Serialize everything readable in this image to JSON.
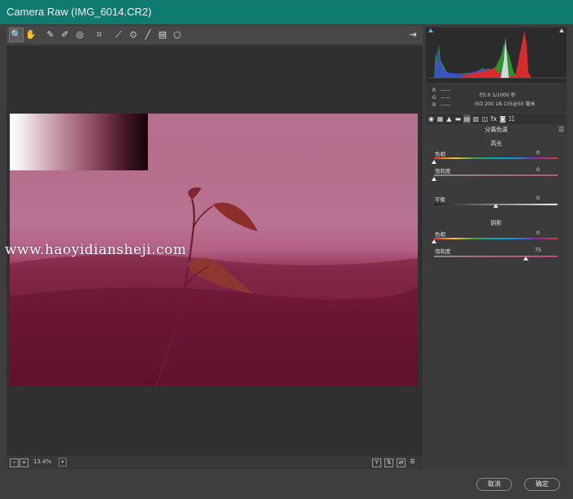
{
  "window": {
    "title": "Camera Raw (IMG_6014.CR2)"
  },
  "toolbar": {
    "tools": [
      {
        "name": "zoom-tool",
        "glyph": "🔍"
      },
      {
        "name": "hand-tool",
        "glyph": "✋"
      },
      {
        "name": "white-balance-tool",
        "glyph": "✎"
      },
      {
        "name": "color-sampler-tool",
        "glyph": "✐"
      },
      {
        "name": "targeted-adjustment-tool",
        "glyph": "◎"
      },
      {
        "name": "crop-tool",
        "glyph": "⌗"
      },
      {
        "name": "straighten-tool",
        "glyph": "⟋"
      },
      {
        "name": "red-eye-tool",
        "glyph": "⊙"
      },
      {
        "name": "brush-tool",
        "glyph": "╱"
      },
      {
        "name": "graduated-filter-tool",
        "glyph": "▤"
      },
      {
        "name": "radial-filter-tool",
        "glyph": "○"
      }
    ],
    "open_glyph": "⇥"
  },
  "watermark": {
    "text": "www.haoyidiansheji.com"
  },
  "statusbar": {
    "zoom_out": "−",
    "zoom_in": "+",
    "zoom": "13.4%",
    "dd": "▾",
    "btn_y": "Y",
    "btn_a": "⇅",
    "btn_b": "⇄",
    "btn_c": "☰"
  },
  "meta": {
    "r_label": "R",
    "g_label": "G",
    "b_label": "B",
    "r_val": "——",
    "g_val": "——",
    "b_val": "——",
    "aperture_shutter": "f/5.6   1/1000 秒",
    "iso_lens": "ISO 200   18-135@50 毫米"
  },
  "panel": {
    "title": "分离色调",
    "highlights": "高光",
    "hl_hue_label": "色相",
    "hl_hue_value": "0",
    "hl_sat_label": "饱和度",
    "hl_sat_value": "0",
    "balance_label": "平衡",
    "balance_value": "0",
    "shadows": "阴影",
    "sh_hue_label": "色相",
    "sh_hue_value": "0",
    "sh_sat_label": "饱和度",
    "sh_sat_value": "75"
  },
  "tabs": [
    "◉",
    "▦",
    "▲",
    "▬",
    "▤",
    "▥",
    "◫",
    "fx",
    "◙",
    "☷"
  ],
  "buttons": {
    "cancel": "取消",
    "ok": "确定"
  }
}
